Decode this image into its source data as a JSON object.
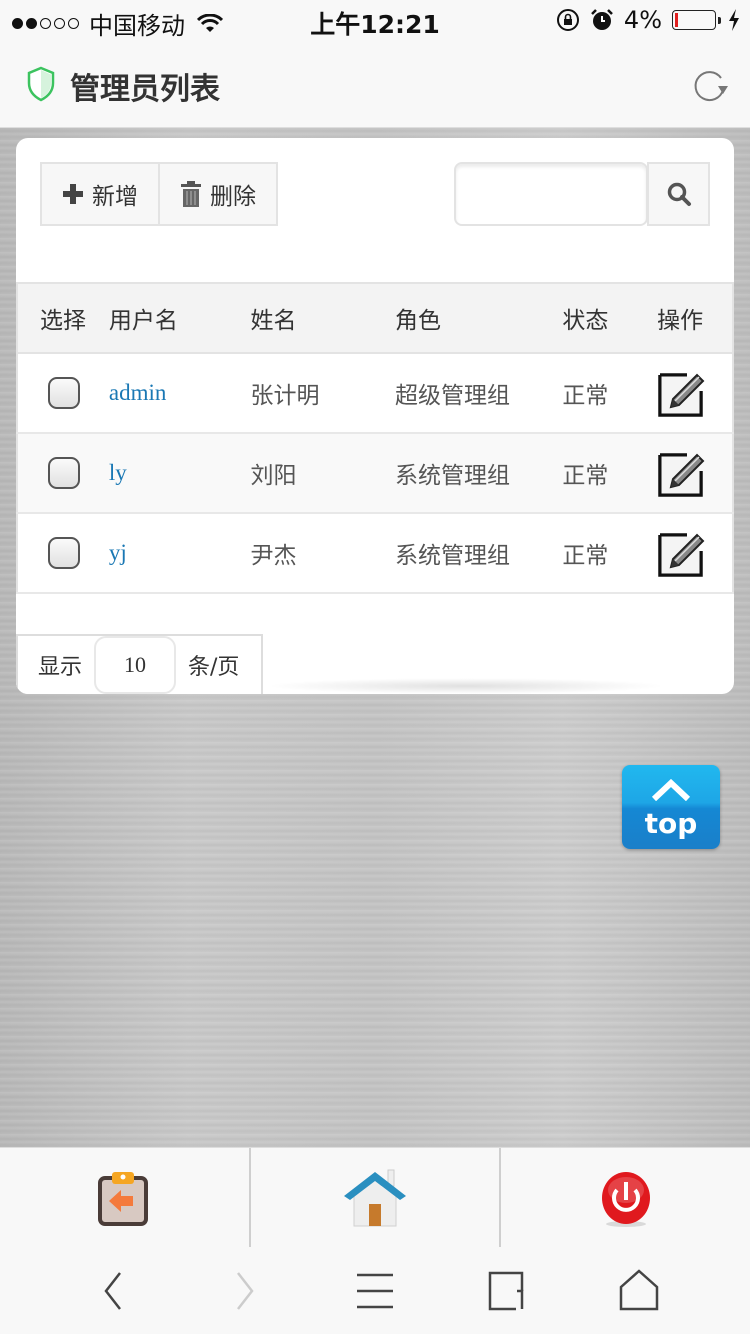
{
  "status_bar": {
    "carrier": "中国移动",
    "signal_bars_filled": 2,
    "signal_bars_total": 5,
    "time": "上午12:21",
    "battery_percent": "4%",
    "icons": [
      "wifi-icon",
      "rotation-lock-icon",
      "alarm-icon",
      "battery-icon",
      "charging-bolt-icon"
    ]
  },
  "header": {
    "title": "管理员列表",
    "icon": "shield-icon",
    "refresh_icon": "refresh-icon",
    "accent": "#3cc35f"
  },
  "toolbar": {
    "add_label": "新增",
    "add_icon": "plus-icon",
    "delete_label": "删除",
    "delete_icon": "trash-icon",
    "search_value": "",
    "search_placeholder": "",
    "search_icon": "search-icon"
  },
  "table": {
    "columns": [
      "选择",
      "用户名",
      "姓名",
      "角色",
      "状态",
      "操作"
    ],
    "rows": [
      {
        "checked": false,
        "username": "admin",
        "name": "张计明",
        "role": "超级管理组",
        "status": "正常",
        "action_icon": "edit-icon"
      },
      {
        "checked": false,
        "username": "ly",
        "name": "刘阳",
        "role": "系统管理组",
        "status": "正常",
        "action_icon": "edit-icon"
      },
      {
        "checked": false,
        "username": "yj",
        "name": "尹杰",
        "role": "系统管理组",
        "status": "正常",
        "action_icon": "edit-icon"
      }
    ],
    "link_color": "#1a78b4"
  },
  "pager": {
    "prefix": "显示",
    "page_size": "10",
    "suffix": "条/页"
  },
  "top_button": {
    "label": "top",
    "color": "#1a9de0"
  },
  "app_nav": {
    "items": [
      {
        "name": "back-clipboard",
        "icon": "clipboard-back-icon"
      },
      {
        "name": "home",
        "icon": "home-icon"
      },
      {
        "name": "logout",
        "icon": "power-icon"
      }
    ]
  },
  "browser_bar": {
    "items": [
      "back-icon",
      "forward-icon",
      "menu-icon",
      "tabs-icon",
      "home-icon"
    ]
  }
}
